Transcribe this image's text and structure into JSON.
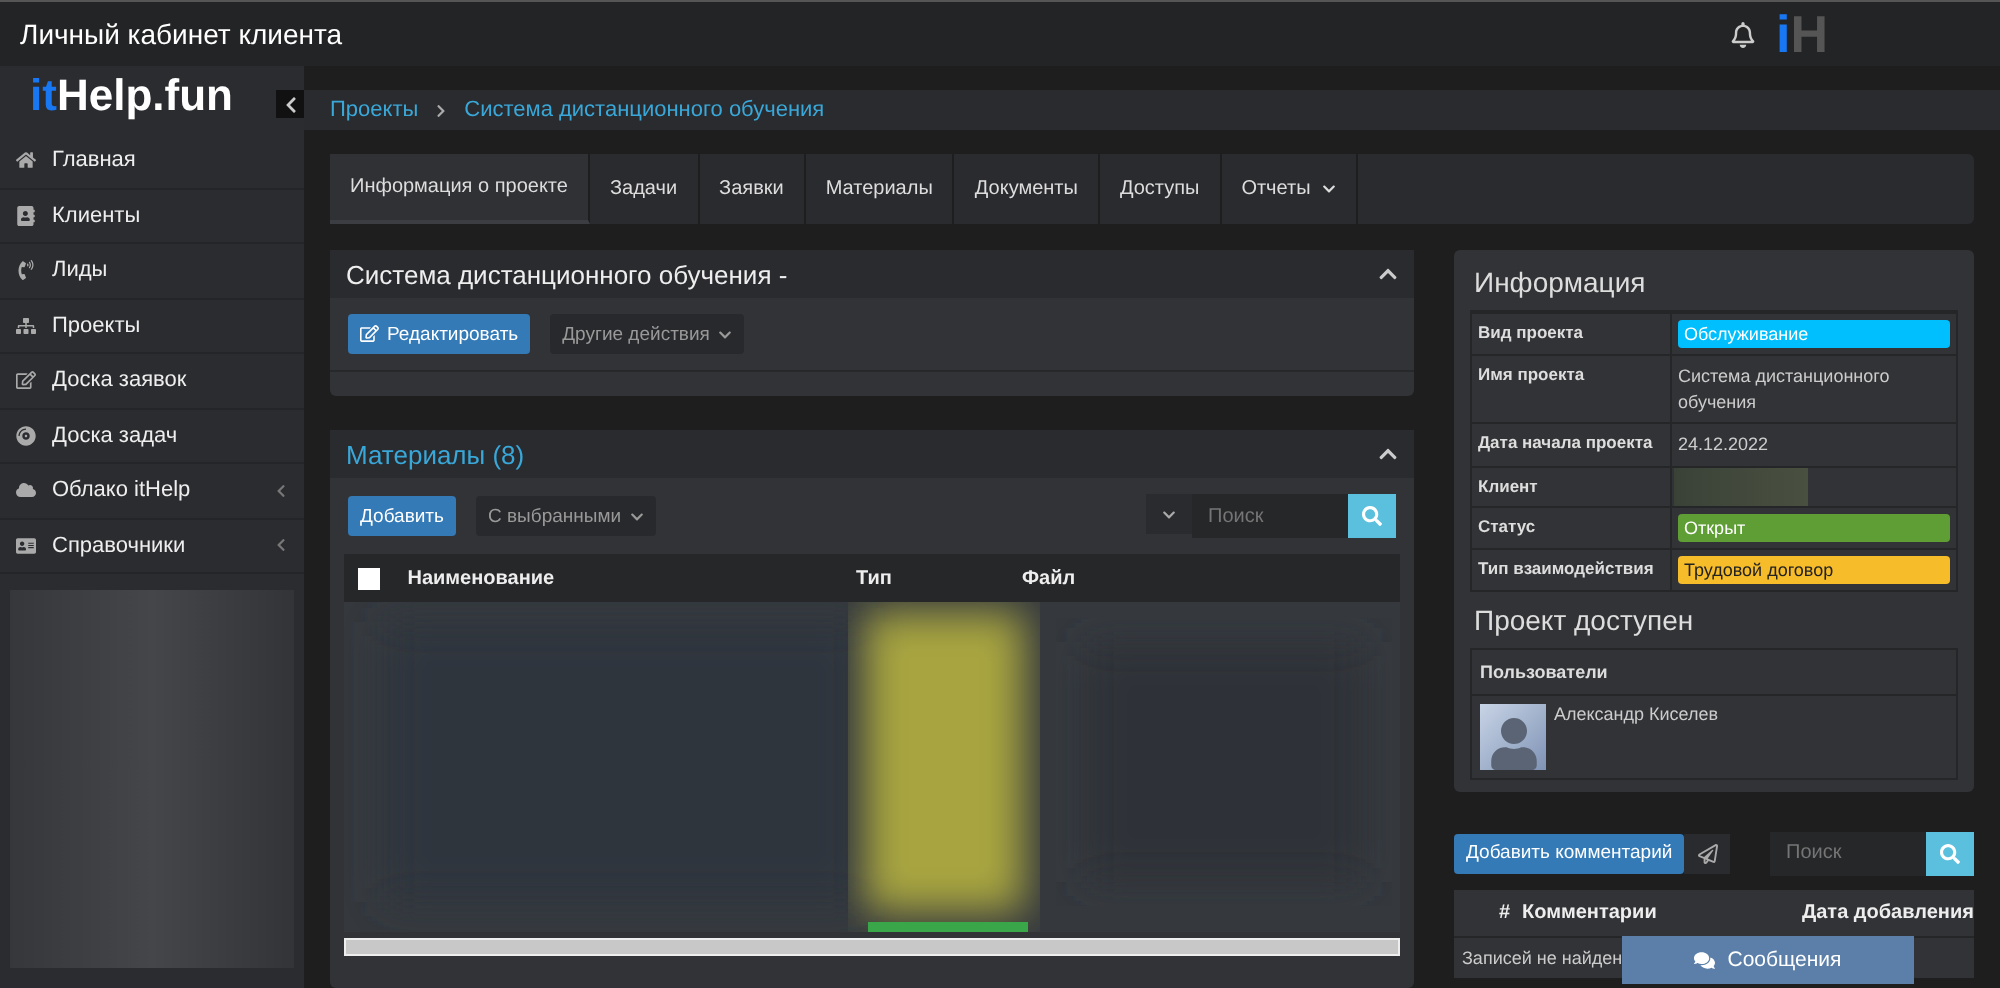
{
  "header": {
    "title": "Личный кабинет клиента",
    "brand_mark": {
      "accent": "i",
      "rest": "H"
    }
  },
  "sidebar": {
    "logo": {
      "accent": "it",
      "rest": "Help.fun"
    },
    "items": [
      {
        "label": "Главная",
        "expandable": false
      },
      {
        "label": "Клиенты",
        "expandable": false
      },
      {
        "label": "Лиды",
        "expandable": false
      },
      {
        "label": "Проекты",
        "expandable": false
      },
      {
        "label": "Доска заявок",
        "expandable": false
      },
      {
        "label": "Доска задач",
        "expandable": false
      },
      {
        "label": "Облако itHelp",
        "expandable": true
      },
      {
        "label": "Справочники",
        "expandable": true
      }
    ]
  },
  "breadcrumbs": [
    "Проекты",
    "Система дистанционного обучения"
  ],
  "tabs": [
    {
      "label": "Информация о проекте",
      "selected": true,
      "dropdown": false
    },
    {
      "label": "Задачи",
      "selected": false,
      "dropdown": false
    },
    {
      "label": "Заявки",
      "selected": false,
      "dropdown": false
    },
    {
      "label": "Материалы",
      "selected": false,
      "dropdown": false
    },
    {
      "label": "Документы",
      "selected": false,
      "dropdown": false
    },
    {
      "label": "Доступы",
      "selected": false,
      "dropdown": false
    },
    {
      "label": "Отчеты",
      "selected": false,
      "dropdown": true
    }
  ],
  "project_panel": {
    "title": "Система дистанционного обучения -",
    "buttons": [
      "Редактировать",
      "Другие действия"
    ]
  },
  "materials": {
    "title": "Материалы (8)",
    "add_button": "Добавить",
    "bulk_select": "С выбранными",
    "search": {
      "placeholder": "Поиск"
    },
    "select_all": {
      "checked": false
    },
    "columns": [
      "Наименование",
      "Тип",
      "Файл"
    ]
  },
  "info": {
    "title": "Информация",
    "rows": [
      {
        "label": "Вид проекта",
        "kind": "badge",
        "value": "Обслуживание",
        "color": "#00bfff"
      },
      {
        "label": "Имя проекта",
        "kind": "text",
        "value": "Система дистанционного обучения"
      },
      {
        "label": "Дата начала проекта",
        "kind": "text",
        "value": "24.12.2022"
      },
      {
        "label": "Клиент",
        "kind": "hidden"
      },
      {
        "label": "Статус",
        "kind": "badge",
        "value": "Открыт",
        "color": "#5f9e34"
      },
      {
        "label": "Тип взаимодействия",
        "kind": "badge",
        "value": "Трудовой договор",
        "color": "#f7bc2a"
      }
    ]
  },
  "access": {
    "title": "Проект доступен",
    "column": "Пользователи",
    "users": [
      "Александр Киселев"
    ]
  },
  "comments": {
    "add_button": "Добавить комментарий",
    "search": {
      "placeholder": "Поиск"
    },
    "columns": [
      "#",
      "Комментарии",
      "Дата добавления"
    ],
    "empty": "Записей не найден"
  },
  "messages_button": "Сообщения"
}
